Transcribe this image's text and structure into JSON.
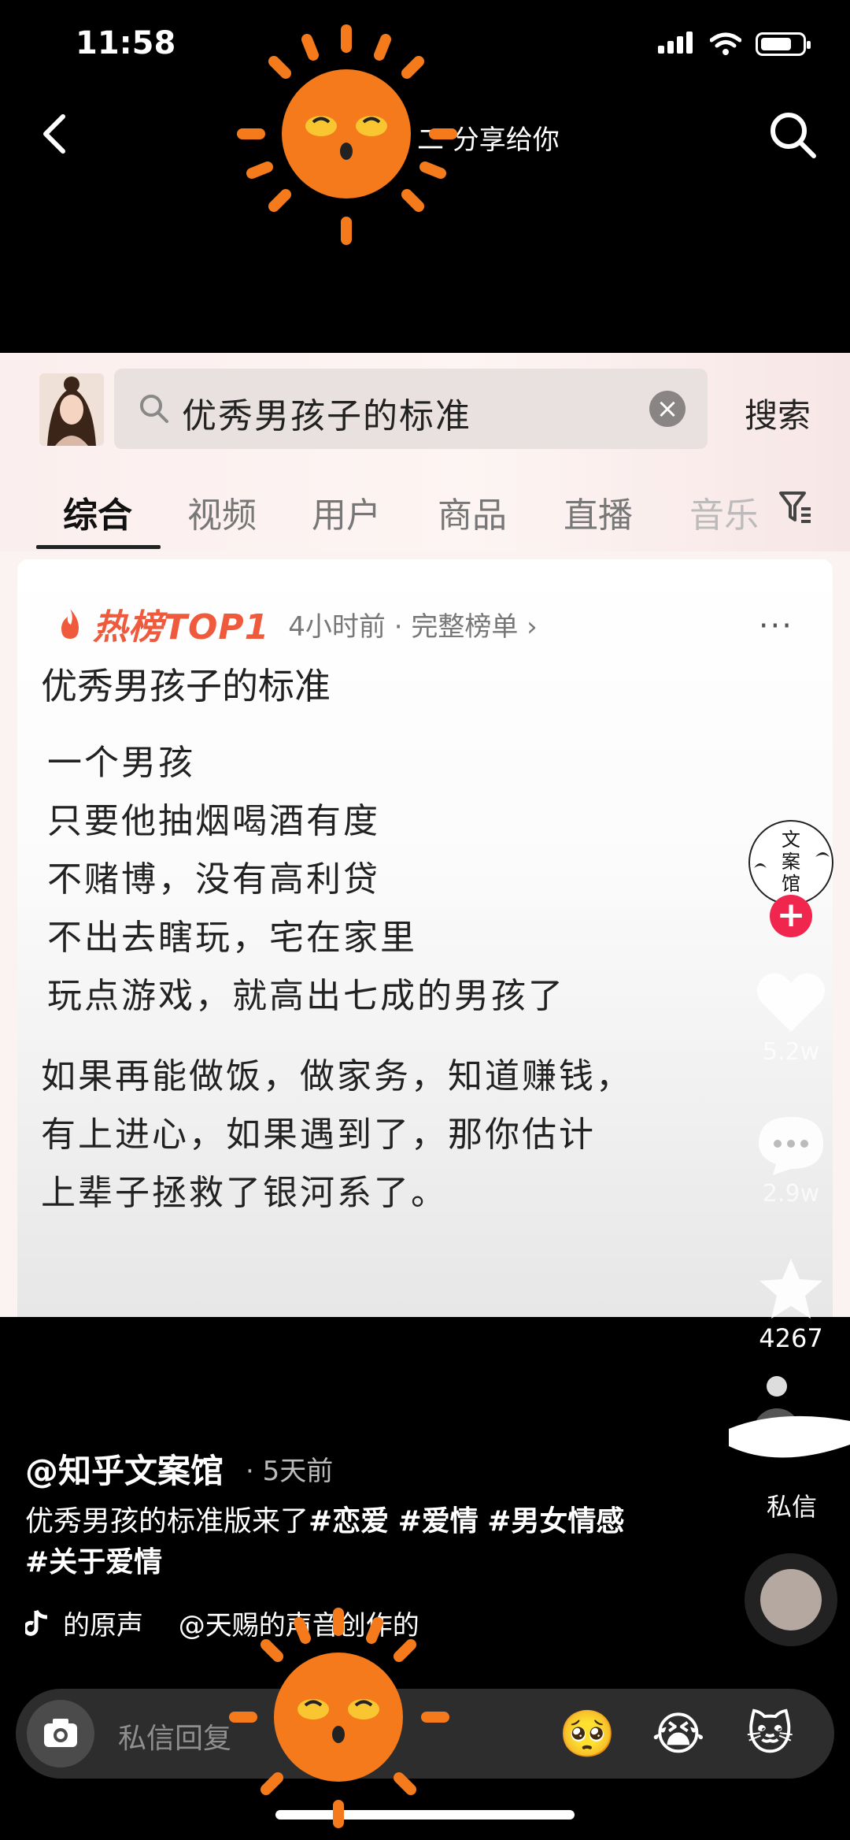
{
  "status_bar": {
    "time": "11:58"
  },
  "top_nav": {
    "share_text": "二 分享给你"
  },
  "embed": {
    "search": {
      "query": "优秀男孩子的标准",
      "clear_label": "×",
      "submit_label": "搜索"
    },
    "tabs": [
      "综合",
      "视频",
      "用户",
      "商品",
      "直播",
      "音乐"
    ],
    "active_tab": 0,
    "hot_badge": "热榜TOP1",
    "hot_meta": "4小时前 · 完整榜单 ›",
    "more_label": "···",
    "post_title": "优秀男孩子的标准",
    "poem_lines": [
      "一个男孩",
      "只要他抽烟喝酒有度",
      "不赌博，没有高利贷",
      "不出去瞎玩，宅在家里",
      "玩点游戏，就高出七成的男孩了"
    ],
    "para2_lines": [
      "如果再能做饭，做家务，知道赚钱，",
      "有上进心，如果遇到了，那你估计",
      "上辈子拯救了银河系了。"
    ]
  },
  "right_rail": {
    "creator_logo_text": "文案馆",
    "like_count": "5.2w",
    "comment_count": "2.9w",
    "favorite_count": "4267",
    "dm_label": "私信"
  },
  "post": {
    "author": "@知乎文案馆",
    "time_ago": "· 5天前",
    "caption_plain": "优秀男孩的标准版来了",
    "hashtags": [
      "#恋爱",
      "#爱情",
      "#男女情感",
      "#关于爱情"
    ],
    "music": "的原声　 @天赐的声音创作的"
  },
  "bottom_bar": {
    "placeholder": "私信回复",
    "emojis": [
      "🥺",
      "😭",
      "🐱"
    ]
  },
  "colors": {
    "accent": "#f0264f",
    "hot": "#f05a3c",
    "sun": "#f47a1c"
  }
}
